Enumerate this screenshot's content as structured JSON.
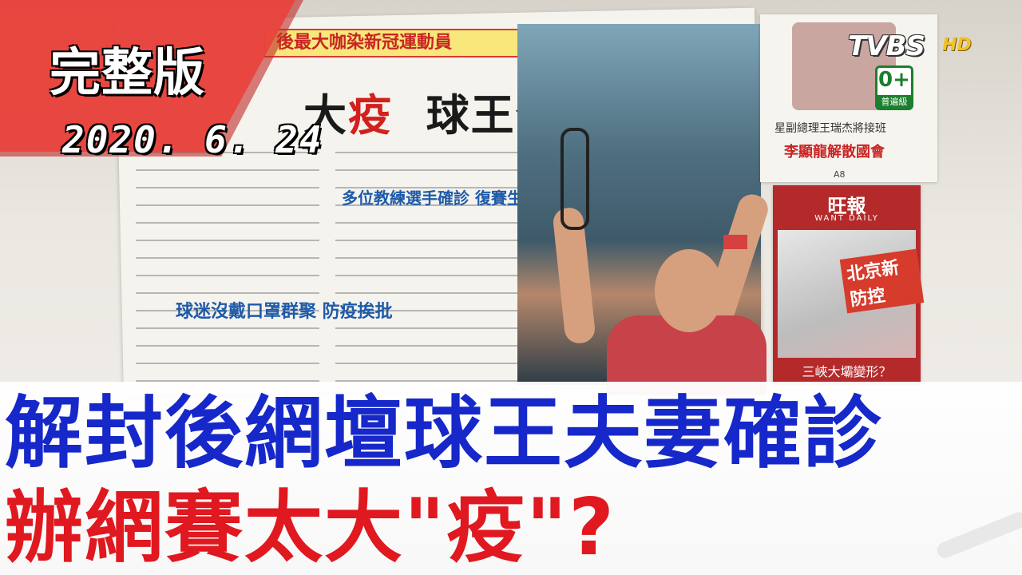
{
  "overlay": {
    "full_label": "完整版",
    "date": "2020. 6. 24"
  },
  "logo": {
    "brand": "TVBS",
    "hd": "HD",
    "rating_symbol": "0+",
    "rating_text": "普遍級"
  },
  "newspaper": {
    "banner": "後最大咖染新冠運動員",
    "headline_prefix": "大",
    "headline_red": "疫",
    "headline_main": "球王喬帥夫妻中鏢",
    "subhead_left": "球迷沒戴口罩群聚 防疫挨批",
    "subhead_right": "多位教練選手確診 復賽生變"
  },
  "side_paper_top": {
    "line1": "星副總理王瑞杰將接班",
    "line2": "李顯龍解散國會",
    "page": "A8"
  },
  "side_paper_bottom": {
    "masthead": "旺報",
    "masthead_en": "WANT DAILY",
    "badge": "北京新防控",
    "caption": "三峽大壩變形？"
  },
  "title": {
    "line1": "解封後網壇球王夫妻確診",
    "line2": "辦網賽太大\"疫\"?"
  }
}
